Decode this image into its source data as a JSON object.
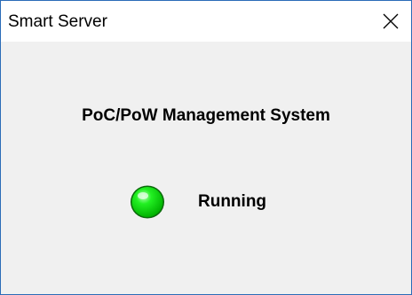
{
  "window": {
    "title": "Smart Server"
  },
  "main": {
    "heading": "PoC/PoW Management System",
    "status": {
      "label": "Running",
      "indicator_color": "#00e600"
    }
  },
  "icons": {
    "close": "close-icon",
    "status": "status-led-icon"
  },
  "colors": {
    "window_border": "#2b6cb8",
    "titlebar_bg": "#ffffff",
    "content_bg": "#f0f0f0",
    "led_green": "#00e600"
  }
}
